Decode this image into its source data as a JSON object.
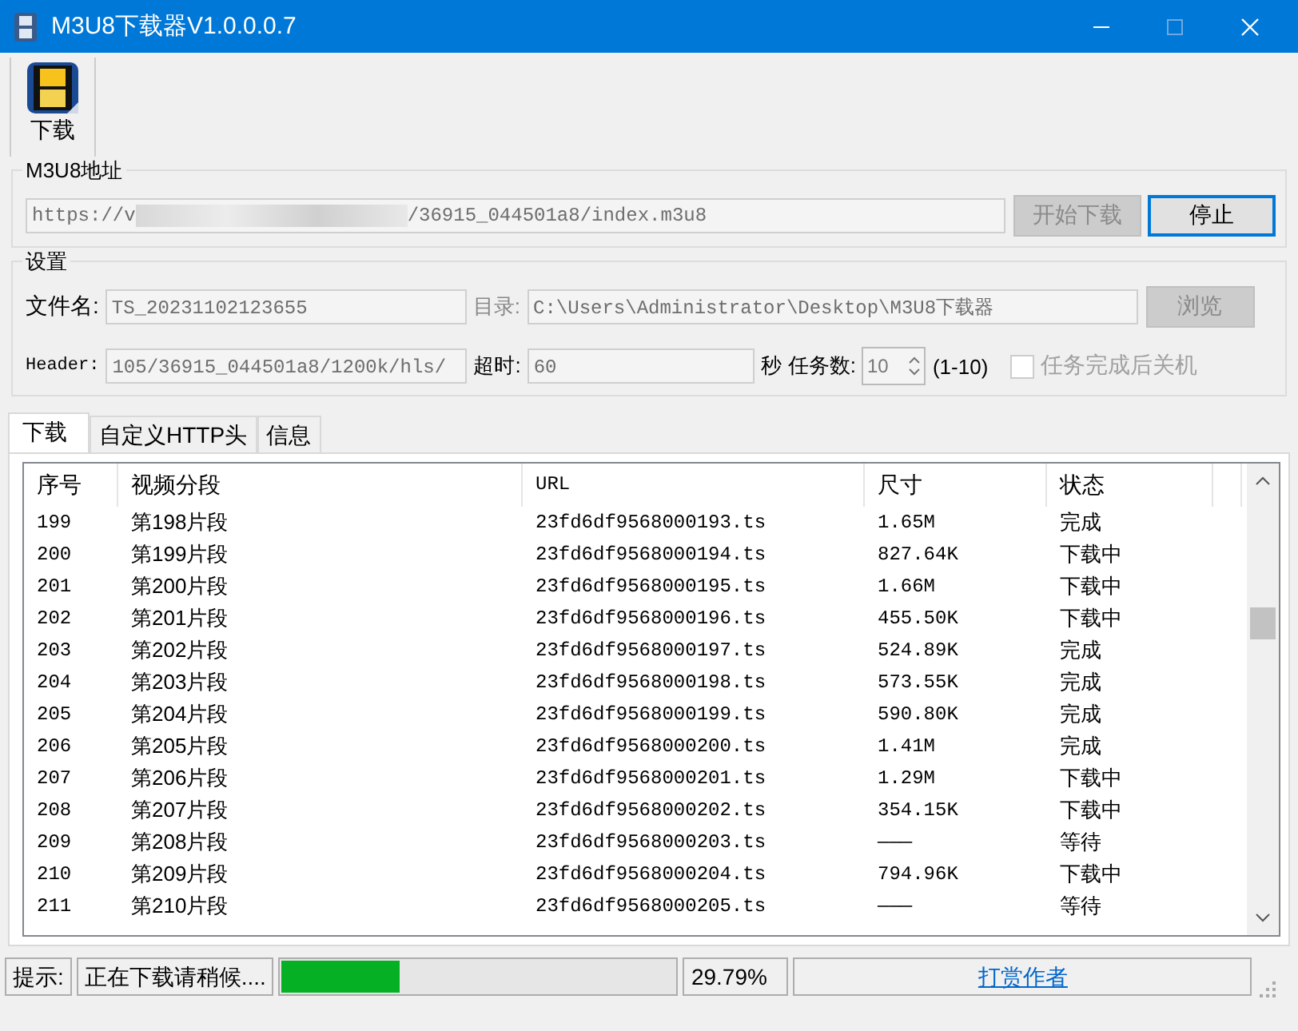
{
  "window": {
    "title": "M3U8下载器V1.0.0.0.7"
  },
  "toolbar": [
    {
      "label": "下载"
    }
  ],
  "url_group": {
    "title": "M3U8地址",
    "url_start": "https://v",
    "url_end": "/36915_044501a8/index.m3u8",
    "buttons": [
      {
        "label": "开始下载",
        "disabled": true,
        "focused": false
      },
      {
        "label": "停止",
        "disabled": false,
        "focused": true
      }
    ]
  },
  "settings": {
    "title": "设置",
    "file_name_label": "文件名:",
    "file_name": "TS_20231102123655",
    "dir_label": "目录:",
    "dir": "C:\\Users\\Administrator\\Desktop\\M3U8下载器",
    "browse": {
      "label": "浏览",
      "disabled": true
    },
    "header_label": "Header:",
    "header": "105/36915_044501a8/1200k/hls/",
    "timeout_label": "超时:",
    "timeout": "60",
    "seconds": "秒",
    "tasks_label": "任务数:",
    "tasks": "10",
    "tasks_range": "(1-10)",
    "shutdown": {
      "label": "任务完成后关机",
      "checked": false,
      "disabled": true
    }
  },
  "tabs": [
    {
      "label": "下载",
      "selected": true
    },
    {
      "label": "自定义HTTP头",
      "selected": false
    },
    {
      "label": "信息",
      "selected": false
    }
  ],
  "table": {
    "columns": [
      "序号",
      "视频分段",
      "URL",
      "尺寸",
      "状态"
    ],
    "rows": [
      [
        "199",
        "第198片段",
        "23fd6df9568000193.ts",
        "1.65M",
        "完成"
      ],
      [
        "200",
        "第199片段",
        "23fd6df9568000194.ts",
        "827.64K",
        "下载中"
      ],
      [
        "201",
        "第200片段",
        "23fd6df9568000195.ts",
        "1.66M",
        "下载中"
      ],
      [
        "202",
        "第201片段",
        "23fd6df9568000196.ts",
        "455.50K",
        "下载中"
      ],
      [
        "203",
        "第202片段",
        "23fd6df9568000197.ts",
        "524.89K",
        "完成"
      ],
      [
        "204",
        "第203片段",
        "23fd6df9568000198.ts",
        "573.55K",
        "完成"
      ],
      [
        "205",
        "第204片段",
        "23fd6df9568000199.ts",
        "590.80K",
        "完成"
      ],
      [
        "206",
        "第205片段",
        "23fd6df9568000200.ts",
        "1.41M",
        "完成"
      ],
      [
        "207",
        "第206片段",
        "23fd6df9568000201.ts",
        "1.29M",
        "下载中"
      ],
      [
        "208",
        "第207片段",
        "23fd6df9568000202.ts",
        "354.15K",
        "下载中"
      ],
      [
        "209",
        "第208片段",
        "23fd6df9568000203.ts",
        "———",
        "等待"
      ],
      [
        "210",
        "第209片段",
        "23fd6df9568000204.ts",
        "794.96K",
        "下载中"
      ],
      [
        "211",
        "第210片段",
        "23fd6df9568000205.ts",
        "———",
        "等待"
      ]
    ]
  },
  "status_bar": {
    "hint_label": "提示:",
    "message": "正在下载请稍候....",
    "progress": {
      "level": 0.2979
    },
    "percent": "29.79%",
    "link": "打赏作者"
  }
}
